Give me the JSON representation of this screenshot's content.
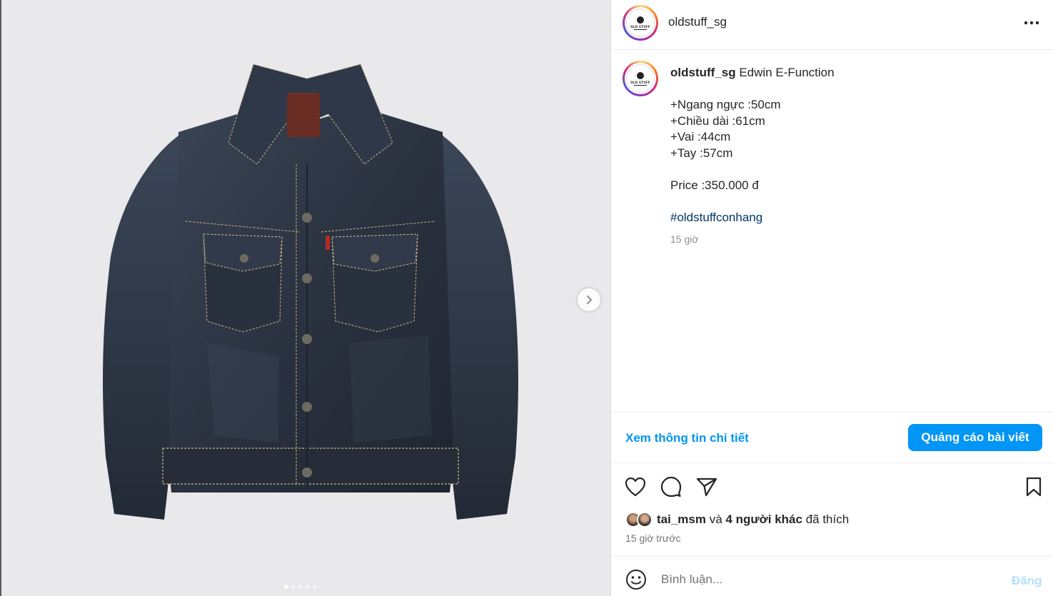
{
  "post": {
    "username": "oldstuff_sg",
    "avatar_text": "OLD STUFF",
    "more_icon": "more-horizontal-icon"
  },
  "caption": {
    "username": "oldstuff_sg",
    "title": "Edwin E-Function",
    "lines": [
      "+Ngang ngực :50cm",
      "+Chiều dài :61cm",
      "+Vai :44cm",
      "+Tay :57cm"
    ],
    "price": "Price :350.000 đ",
    "hashtag": "#oldstuffconhang",
    "time": "15 giờ"
  },
  "promo": {
    "details_link": "Xem thông tin chi tiết",
    "boost_button": "Quảng cáo bài viết"
  },
  "likes": {
    "first_user": "tai_msm",
    "connector": "và",
    "others": "4 người khác",
    "suffix": "đã thích",
    "time_ago": "15 giờ trước"
  },
  "comment": {
    "placeholder": "Bình luận...",
    "post_label": "Đăng"
  },
  "carousel": {
    "slide_count": 5,
    "active_index": 0
  },
  "colors": {
    "accent": "#0095f6",
    "hashtag": "#00376b",
    "muted": "#737373",
    "denim": "#2c3340"
  }
}
